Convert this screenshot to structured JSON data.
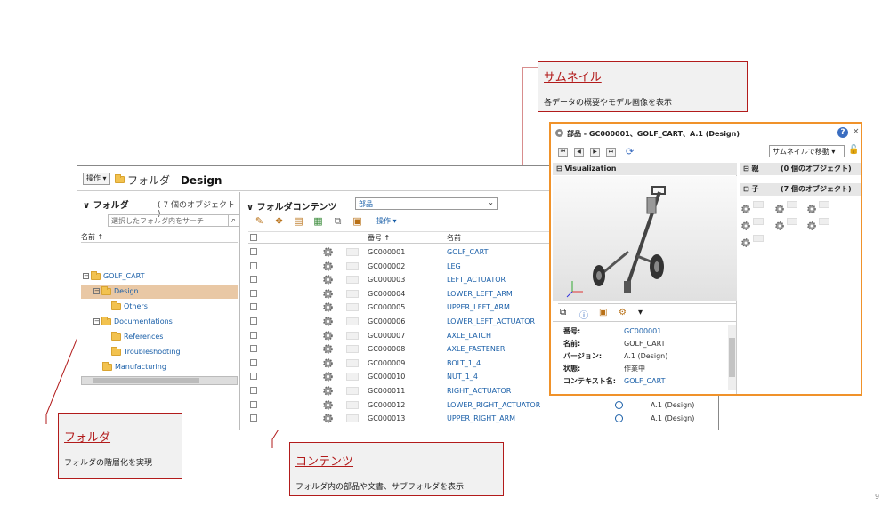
{
  "main_window": {
    "ops_label": "操作 ▾",
    "title_prefix": "フォルダ - ",
    "title_bold": "Design"
  },
  "folder_pane": {
    "header": "∨ フォルダ",
    "count": "( 7 個のオブジェクト )",
    "search_placeholder": "選択したフォルダ内をサーチ",
    "column_name": "名前 ↑",
    "tree": [
      {
        "label": "GOLF_CART"
      },
      {
        "label": "Design"
      },
      {
        "label": "Others"
      },
      {
        "label": "Documentations"
      },
      {
        "label": "References"
      },
      {
        "label": "Troubleshooting"
      },
      {
        "label": "Manufacturing"
      }
    ]
  },
  "content_pane": {
    "header": "∨ フォルダコンテンツ",
    "filter_value": "部品",
    "ops_label": "操作 ▾",
    "col_number": "番号 ↑",
    "col_name": "名前",
    "rows": [
      {
        "number": "GC000001",
        "name": "GOLF_CART"
      },
      {
        "number": "GC000002",
        "name": "LEG"
      },
      {
        "number": "GC000003",
        "name": "LEFT_ACTUATOR"
      },
      {
        "number": "GC000004",
        "name": "LOWER_LEFT_ARM"
      },
      {
        "number": "GC000005",
        "name": "UPPER_LEFT_ARM"
      },
      {
        "number": "GC000006",
        "name": "LOWER_LEFT_ACTUATOR"
      },
      {
        "number": "GC000007",
        "name": "AXLE_LATCH"
      },
      {
        "number": "GC000008",
        "name": "AXLE_FASTENER"
      },
      {
        "number": "GC000009",
        "name": "BOLT_1_4"
      },
      {
        "number": "GC000010",
        "name": "NUT_1_4"
      },
      {
        "number": "GC000011",
        "name": "RIGHT_ACTUATOR"
      },
      {
        "number": "GC000012",
        "name": "LOWER_RIGHT_ACTUATOR",
        "version": "A.1 (Design)"
      },
      {
        "number": "GC000013",
        "name": "UPPER_RIGHT_ARM",
        "version": "A.1 (Design)"
      }
    ]
  },
  "popup": {
    "title": "部品 - GC000001、GOLF_CART、A.1 (Design)",
    "help": "?",
    "close": "×",
    "thumb_move": "サムネイルで移動 ▾",
    "visualization": "⊟ Visualization",
    "props": [
      {
        "key": "番号:",
        "value": "GC000001"
      },
      {
        "key": "名前:",
        "value": "GOLF_CART"
      },
      {
        "key": "バージョン:",
        "value": "A.1 (Design)"
      },
      {
        "key": "状態:",
        "value": "作業中"
      },
      {
        "key": "コンテキスト名:",
        "value": "GOLF_CART"
      }
    ],
    "parent_label": "⊟ 親",
    "parent_count": "(0 個のオブジェクト)",
    "child_label": "⊟ 子",
    "child_count": "(7 個のオブジェクト)"
  },
  "callouts": {
    "thumbnail": {
      "title": "サムネイル",
      "desc": "各データの概要やモデル画像を表示"
    },
    "folder": {
      "title": "フォルダ",
      "desc": "フォルダの階層化を実現"
    },
    "contents": {
      "title": "コンテンツ",
      "desc": "フォルダ内の部品や文書、サブフォルダを表示"
    }
  },
  "slide_number": "9",
  "colors": {
    "accent_orange": "#f0922a",
    "callout_red": "#b21b1b",
    "link_blue": "#1a5fa8",
    "selection": "#e9c8a5"
  }
}
